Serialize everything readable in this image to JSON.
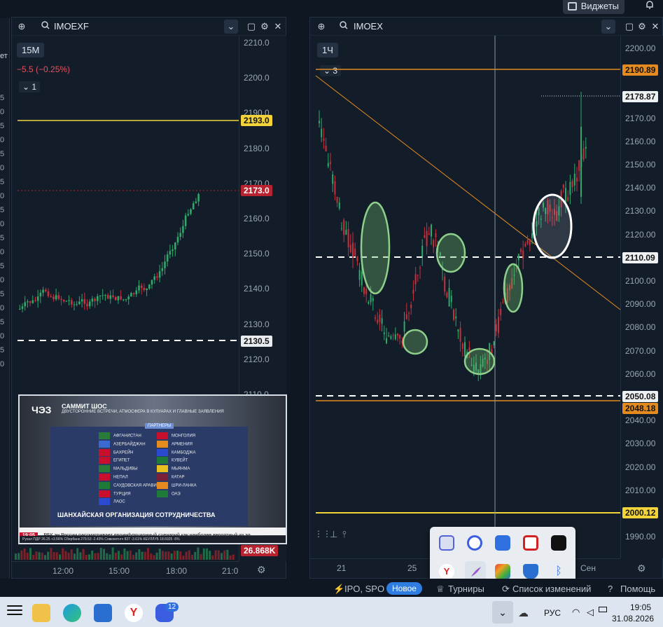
{
  "topbar": {
    "widgets_label": "Виджеты",
    "bell_icon": "bell-icon"
  },
  "left_chart": {
    "ticker": "IMOEXF",
    "timeframe": "15M",
    "change": "−5.5 (−0.25%)",
    "indicator_count": "1",
    "price_ticks": [
      "2210.0",
      "2200.0",
      "2190.0",
      "2180.0",
      "2170.0",
      "2160.0",
      "2150.0",
      "2140.0",
      "2130.0",
      "2120.0",
      "2110.0"
    ],
    "tags": {
      "line_level": "2193.0",
      "last_price": "2173.0",
      "dashed_level": "2130.5",
      "volume": "26.868K"
    },
    "time_labels": [
      "12:00",
      "15:00",
      "18:00",
      "21:0"
    ],
    "edge_partial_label": "ет",
    "edge_digits": [
      "5",
      "0",
      "5",
      "0",
      "5",
      "0",
      "5",
      "0",
      "5",
      "0",
      "5",
      "0",
      "5",
      "0",
      "5",
      "0",
      "5",
      "0",
      "5",
      "0"
    ]
  },
  "right_chart": {
    "ticker": "IMOEX",
    "timeframe": "1Ч",
    "indicator_count": "3",
    "price_ticks": [
      "2200.00",
      "2190.00",
      "2180.00",
      "2170.00",
      "2160.00",
      "2150.00",
      "2140.00",
      "2130.00",
      "2120.00",
      "2110.00",
      "2100.00",
      "2090.00",
      "2080.00",
      "2070.00",
      "2060.00",
      "2050.00",
      "2040.00",
      "2030.00",
      "2020.00",
      "2010.00",
      "2000.00",
      "1990.00"
    ],
    "tags": {
      "upper_level": "2190.89",
      "last_price": "2178.87",
      "dashed_upper": "2110.09",
      "dashed_lower": "2050.08",
      "lower_level": "2048.18",
      "bottom_level": "2000.12"
    },
    "time_labels": [
      "21",
      "25",
      "Сен"
    ]
  },
  "video": {
    "brand": "ЧЭЗ",
    "title": "САММИТ ШОС",
    "subtitle": "ДВУСТОРОННИЕ ВСТРЕЧИ, АТМОСФЕРА В КУЛУАРАХ И ГЛАВНЫЕ ЗАЯВЛЕНИЯ",
    "partners_label": "ПАРТНЕРЫ",
    "countries_left": [
      "АФГАНИСТАН",
      "АЗЕРБАЙДЖАН",
      "БАХРЕЙН",
      "ЕГИПЕТ",
      "МАЛЬДИВЫ",
      "НЕПАЛ",
      "САУДОВСКАЯ АРАВИЯ",
      "ТУРЦИЯ",
      "ЛАОС"
    ],
    "countries_right": [
      "МОНГОЛИЯ",
      "АРМЕНИЯ",
      "КАМБОДЖА",
      "КУВЕЙТ",
      "МЬЯНМА",
      "КАТАР",
      "ШРИ-ЛАНКА",
      "ОАЭ"
    ],
    "banner": "ШАНХАЙСКАЯ ОРГАНИЗАЦИЯ СОТРУДНИЧЕСТВА",
    "time": "19:05",
    "ticker_line": "РБК эн России рассматривает проинфляционный сценарий как наиболее вероятный из эл",
    "markets_line": "Рухал ПДР 26.25 +3.56%    Сбербанк 279.53 -2.43%    Совкомтнгч 837 -3.61%    КЕУЛЛУБ 18.6925 -5%"
  },
  "statusbar": {
    "ipo": "IPO, SPO",
    "new_badge": "Новое",
    "tournaments": "Турниры",
    "changes": "Список изменений",
    "help": "Помощь"
  },
  "taskbar": {
    "badge_count": "12",
    "lang": "РУС",
    "time": "19:05",
    "date": "31.08.2026"
  }
}
